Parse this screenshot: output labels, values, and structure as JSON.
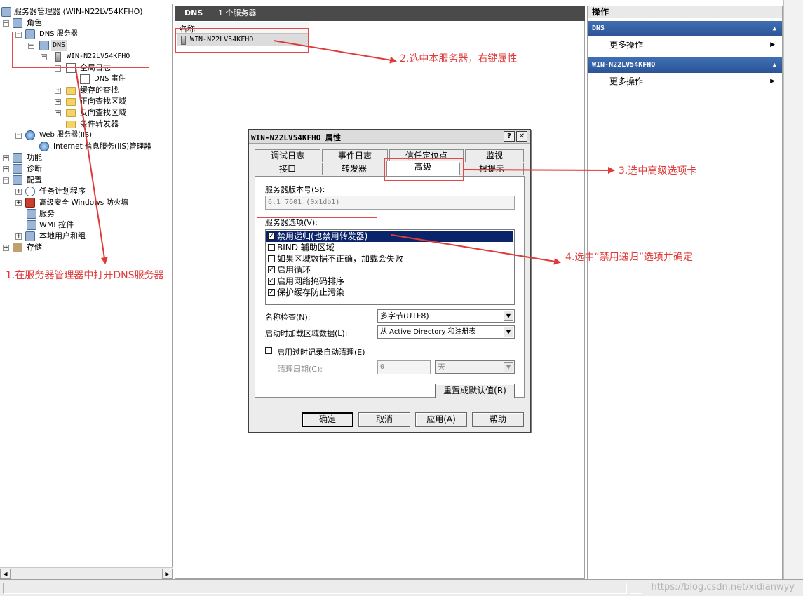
{
  "tree": {
    "items": [
      {
        "label": "服务器管理器 (WIN-N22LV54KFHO)",
        "icon": "server-manager-icon"
      },
      {
        "label": "角色",
        "icon": "roles-icon"
      },
      {
        "label": "DNS 服务器",
        "icon": "dns-server-icon"
      },
      {
        "label": "DNS",
        "icon": "dns-icon"
      },
      {
        "label": "WIN-N22LV54KFHO",
        "icon": "server-icon"
      },
      {
        "label": "全局日志",
        "icon": "log-icon"
      },
      {
        "label": "DNS 事件",
        "icon": "event-log-icon"
      },
      {
        "label": "缓存的查找",
        "icon": "folder-icon"
      },
      {
        "label": "正向查找区域",
        "icon": "folder-icon"
      },
      {
        "label": "反向查找区域",
        "icon": "folder-icon"
      },
      {
        "label": "条件转发器",
        "icon": "folder-icon"
      },
      {
        "label": "Web 服务器(IIS)",
        "icon": "web-server-icon"
      },
      {
        "label": "Internet 信息服务(IIS)管理器",
        "icon": "iis-manager-icon"
      },
      {
        "label": "功能",
        "icon": "features-icon"
      },
      {
        "label": "诊断",
        "icon": "diagnostics-icon"
      },
      {
        "label": "配置",
        "icon": "configuration-icon"
      },
      {
        "label": "任务计划程序",
        "icon": "task-scheduler-icon"
      },
      {
        "label": "高级安全 Windows 防火墙",
        "icon": "firewall-icon"
      },
      {
        "label": "服务",
        "icon": "services-icon"
      },
      {
        "label": "WMI 控件",
        "icon": "wmi-icon"
      },
      {
        "label": "本地用户和组",
        "icon": "users-groups-icon"
      },
      {
        "label": "存储",
        "icon": "storage-icon"
      }
    ]
  },
  "middle": {
    "header_title": "DNS",
    "header_count": "1 个服务器",
    "column_name": "名称",
    "server_name": "WIN-N22LV54KFHO"
  },
  "actions": {
    "title": "操作",
    "sections": [
      {
        "title": "DNS",
        "item": "更多操作"
      },
      {
        "title": "WIN-N22LV54KFHO",
        "item": "更多操作"
      }
    ]
  },
  "dialog": {
    "title": "WIN-N22LV54KFHO 属性",
    "help_btn": "?",
    "close_btn": "✕",
    "tabs_row1": [
      "调试日志",
      "事件日志",
      "信任定位点",
      "监视"
    ],
    "tabs_row2": [
      "接口",
      "转发器",
      "高级",
      "根提示"
    ],
    "version_label": "服务器版本号(S):",
    "version_value": "6.1 7601 (0x1db1)",
    "options_label": "服务器选项(V):",
    "options": [
      {
        "label": "禁用递归(也禁用转发器)",
        "checked": true,
        "selected": true
      },
      {
        "label": "BIND 辅助区域",
        "checked": false,
        "selected": false
      },
      {
        "label": "如果区域数据不正确，加载会失败",
        "checked": false,
        "selected": false
      },
      {
        "label": "启用循环",
        "checked": true,
        "selected": false
      },
      {
        "label": "启用网络掩码排序",
        "checked": true,
        "selected": false
      },
      {
        "label": "保护缓存防止污染",
        "checked": true,
        "selected": false
      }
    ],
    "name_check_label": "名称检查(N):",
    "name_check_value": "多字节(UTF8)",
    "load_zone_label": "启动时加载区域数据(L):",
    "load_zone_value": "从 Active Directory 和注册表",
    "scavenging_label": "启用过时记录自动清理(E)",
    "scavenging_checked": false,
    "period_label": "清理周期(C):",
    "period_value": "0",
    "period_unit": "天",
    "reset_button": "重置成默认值(R)",
    "ok_button": "确定",
    "cancel_button": "取消",
    "apply_button": "应用(A)",
    "help_button": "帮助"
  },
  "annotations": {
    "step1": "1.在服务器管理器中打开DNS服务器",
    "step2": "2.选中本服务器，右键属性",
    "step3": "3.选中高级选项卡",
    "step4": "4.选中“禁用递归”选项并确定",
    "color": "#e03a3a"
  },
  "watermark": "https://blog.csdn.net/xidianwyy",
  "colors": {
    "header_bg": "#4a4a4a",
    "action_section_bg": "#2b5496",
    "selection_bg": "#0a246a"
  }
}
